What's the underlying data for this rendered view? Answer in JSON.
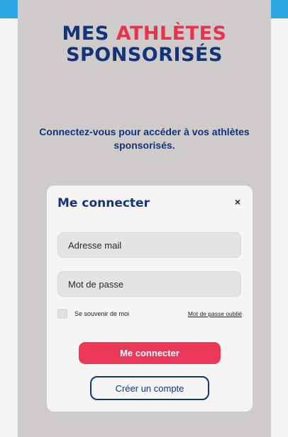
{
  "header": {
    "title_part1": "MES ",
    "title_accent": "ATHLÈTES",
    "title_line2": "SPONSORISÉS"
  },
  "intro": {
    "text": "Connectez-vous pour accéder à vos athlètes sponsorisés."
  },
  "login_card": {
    "title": "Me connecter",
    "close_icon": "×",
    "email_placeholder": "Adresse mail",
    "password_placeholder": "Mot de passe",
    "remember_label": "Se souvenir de moi",
    "forgot_label": "Mot de passe oublié",
    "submit_label": "Me connecter",
    "create_account_label": "Créer un compte"
  },
  "colors": {
    "navy": "#13337a",
    "accent_red": "#e8334f",
    "button_red": "#ec3858",
    "panel_bg": "#cfcbcb",
    "top_band": "#2fa6e4"
  },
  "icons": {
    "close": "close-icon"
  }
}
